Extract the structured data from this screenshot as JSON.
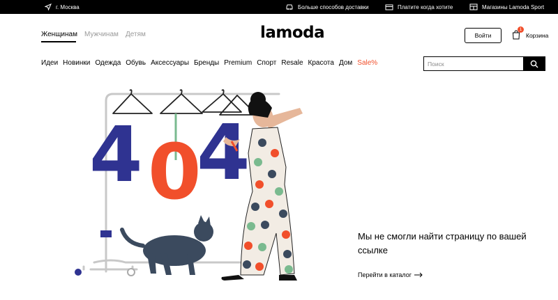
{
  "topbar": {
    "city": "г. Москва",
    "delivery": "Больше способов доставки",
    "pay": "Платите когда хотите",
    "stores": "Магазины Lamoda Sport"
  },
  "header": {
    "genders": [
      "Женщинам",
      "Мужчинам",
      "Детям"
    ],
    "logo": "lamoda",
    "login_label": "Войти",
    "cart_label": "Корзина",
    "cart_count": "1"
  },
  "nav": {
    "items": [
      "Идеи",
      "Новинки",
      "Одежда",
      "Обувь",
      "Аксессуары",
      "Бренды",
      "Premium",
      "Спорт",
      "Resale",
      "Красота",
      "Дом",
      "Sale%"
    ]
  },
  "search": {
    "placeholder": "Поиск"
  },
  "illustration": {
    "number": "404"
  },
  "error": {
    "message": "Мы не смогли найти страницу по вашей ссылке",
    "catalog_link": "Перейти в каталог"
  },
  "colors": {
    "accent": "#f14f2b",
    "navy": "#2f3391",
    "cat": "#3b4a5e"
  }
}
